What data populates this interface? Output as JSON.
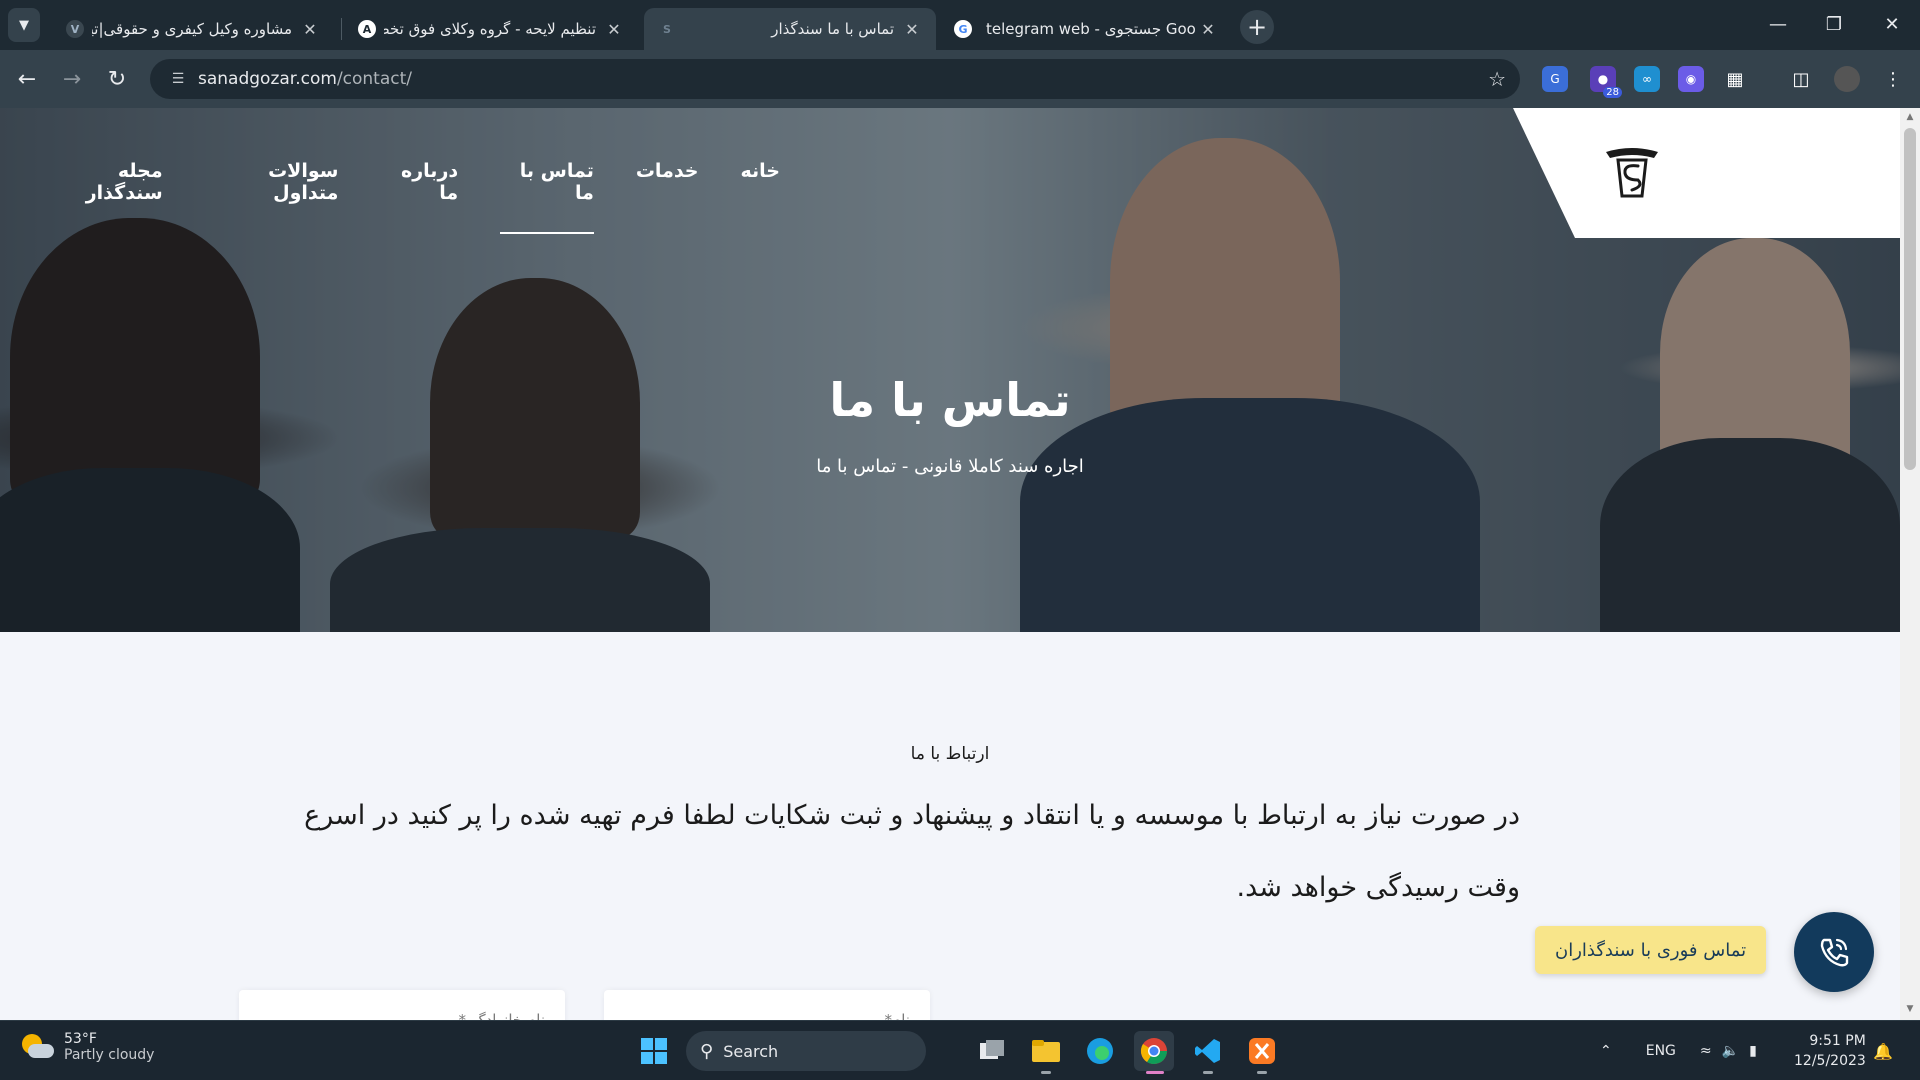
{
  "browser": {
    "tabs": [
      {
        "title": "مشاوره وکیل کیفری و حقوقی|تیم",
        "active": false,
        "icon": "law-firm-favicon"
      },
      {
        "title": "تنظیم لایحه - گروه وکلای فوق تخصص",
        "active": false,
        "icon": "lawyers-group-favicon"
      },
      {
        "title": "تماس با ما سندگذار",
        "active": true,
        "icon": "sanadgozar-favicon"
      },
      {
        "title": "telegram web - جستجوی Google",
        "active": false,
        "icon": "google-favicon"
      }
    ],
    "url_host": "sanadgozar.com",
    "url_path": "/contact/",
    "extension_badge": "28"
  },
  "site": {
    "nav": [
      "خانه",
      "خدمات",
      "تماس با ما",
      "درباره ما",
      "سوالات متداول",
      "مجله سندگذار"
    ],
    "active_nav": "تماس با ما",
    "hero_title": "تماس با ما",
    "hero_subtitle": "اجاره سند کاملا قانونی - تماس با ما",
    "section_eyebrow": "ارتباط با ما",
    "section_text": "در صورت نیاز به ارتباط با موسسه و یا انتقاد و پیشنهاد و ثبت شکایات لطفا فرم تهیه شده را پر کنید در اسرع وقت رسیدگی خواهد شد.",
    "form": {
      "name_placeholder": "نام*",
      "lastname_placeholder": "نام خانوادگی*"
    },
    "call_widget_label": "تماس فوری با سندگذاران",
    "colors": {
      "accent_navy": "#123a5c",
      "call_bubble": "#f8e58a"
    }
  },
  "taskbar": {
    "weather_temp": "53°F",
    "weather_desc": "Partly cloudy",
    "search_label": "Search",
    "language": "ENG",
    "time": "9:51 PM",
    "date": "12/5/2023"
  }
}
